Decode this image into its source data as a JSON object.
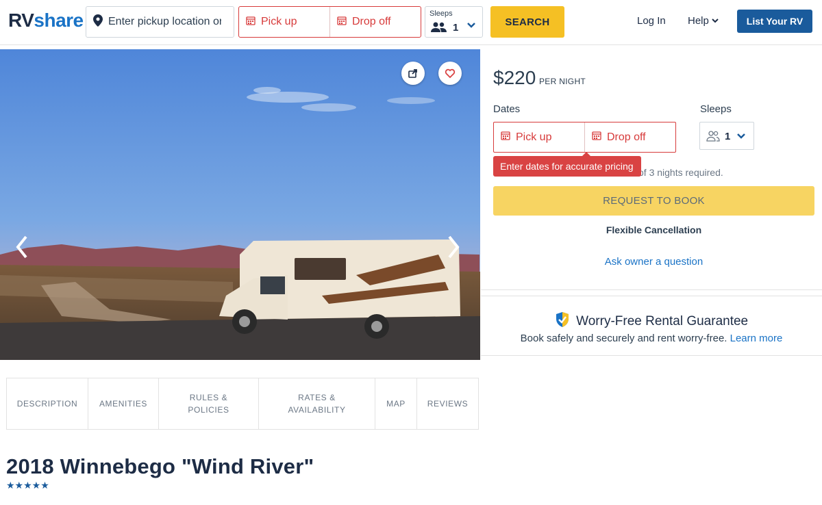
{
  "header": {
    "logo_rv": "RV",
    "logo_share": "share",
    "location_placeholder": "Enter pickup location or city",
    "pickup_label": "Pick up",
    "dropoff_label": "Drop off",
    "sleeps_label": "Sleeps",
    "sleeps_value": "1",
    "search_label": "SEARCH",
    "login_label": "Log In",
    "help_label": "Help",
    "list_rv_label": "List Your RV"
  },
  "booking": {
    "price": "$220",
    "per_night": "PER NIGHT",
    "dates_label": "Dates",
    "sleeps_label": "Sleeps",
    "pickup_label": "Pick up",
    "dropoff_label": "Drop off",
    "sleeps_value": "1",
    "tooltip": "Enter dates for accurate pricing",
    "min_nights": "of 3 nights required.",
    "request_label": "REQUEST TO BOOK",
    "cancellation": "Flexible Cancellation",
    "ask_owner": "Ask owner a question"
  },
  "guarantee": {
    "title": "Worry-Free Rental Guarantee",
    "subtitle": "Book safely and securely and rent worry-free.",
    "learn_more": "Learn more"
  },
  "tabs": [
    {
      "line1": "DESCRIPTION",
      "line2": ""
    },
    {
      "line1": "AMENITIES",
      "line2": ""
    },
    {
      "line1": "RULES &",
      "line2": "POLICIES"
    },
    {
      "line1": "RATES &",
      "line2": "AVAILABILITY"
    },
    {
      "line1": "MAP",
      "line2": ""
    },
    {
      "line1": "REVIEWS",
      "line2": ""
    }
  ],
  "listing": {
    "title": "2018 Winnebego \"Wind River\"",
    "stars": "★★★★★",
    "rating": 5
  },
  "colors": {
    "brand_dark": "#1d2c45",
    "brand_blue": "#1a73c6",
    "search_yellow": "#f5c024",
    "error_red": "#d73a3a",
    "request_yellow": "#f7d462"
  }
}
